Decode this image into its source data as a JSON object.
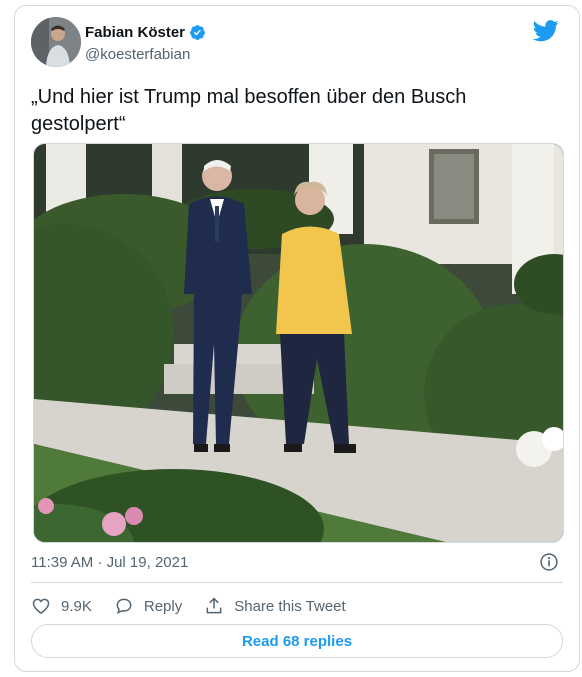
{
  "author": {
    "name": "Fabian Köster",
    "handle": "@koesterfabian",
    "verified": true
  },
  "tweet": {
    "text": "„Und hier ist Trump mal besoffen über den Busch gestolpert“",
    "timestamp": "11:39 AM · Jul 19, 2021"
  },
  "actions": {
    "like_count": "9.9K",
    "reply_label": "Reply",
    "share_label": "Share this Tweet"
  },
  "read_replies_label": "Read 68 replies",
  "colors": {
    "accent": "#1d9bf0",
    "muted_text": "#536471",
    "border": "#cfd9de"
  },
  "icons": [
    "verified-badge-icon",
    "twitter-bird-icon",
    "info-icon",
    "heart-icon",
    "reply-bubble-icon",
    "share-icon"
  ]
}
